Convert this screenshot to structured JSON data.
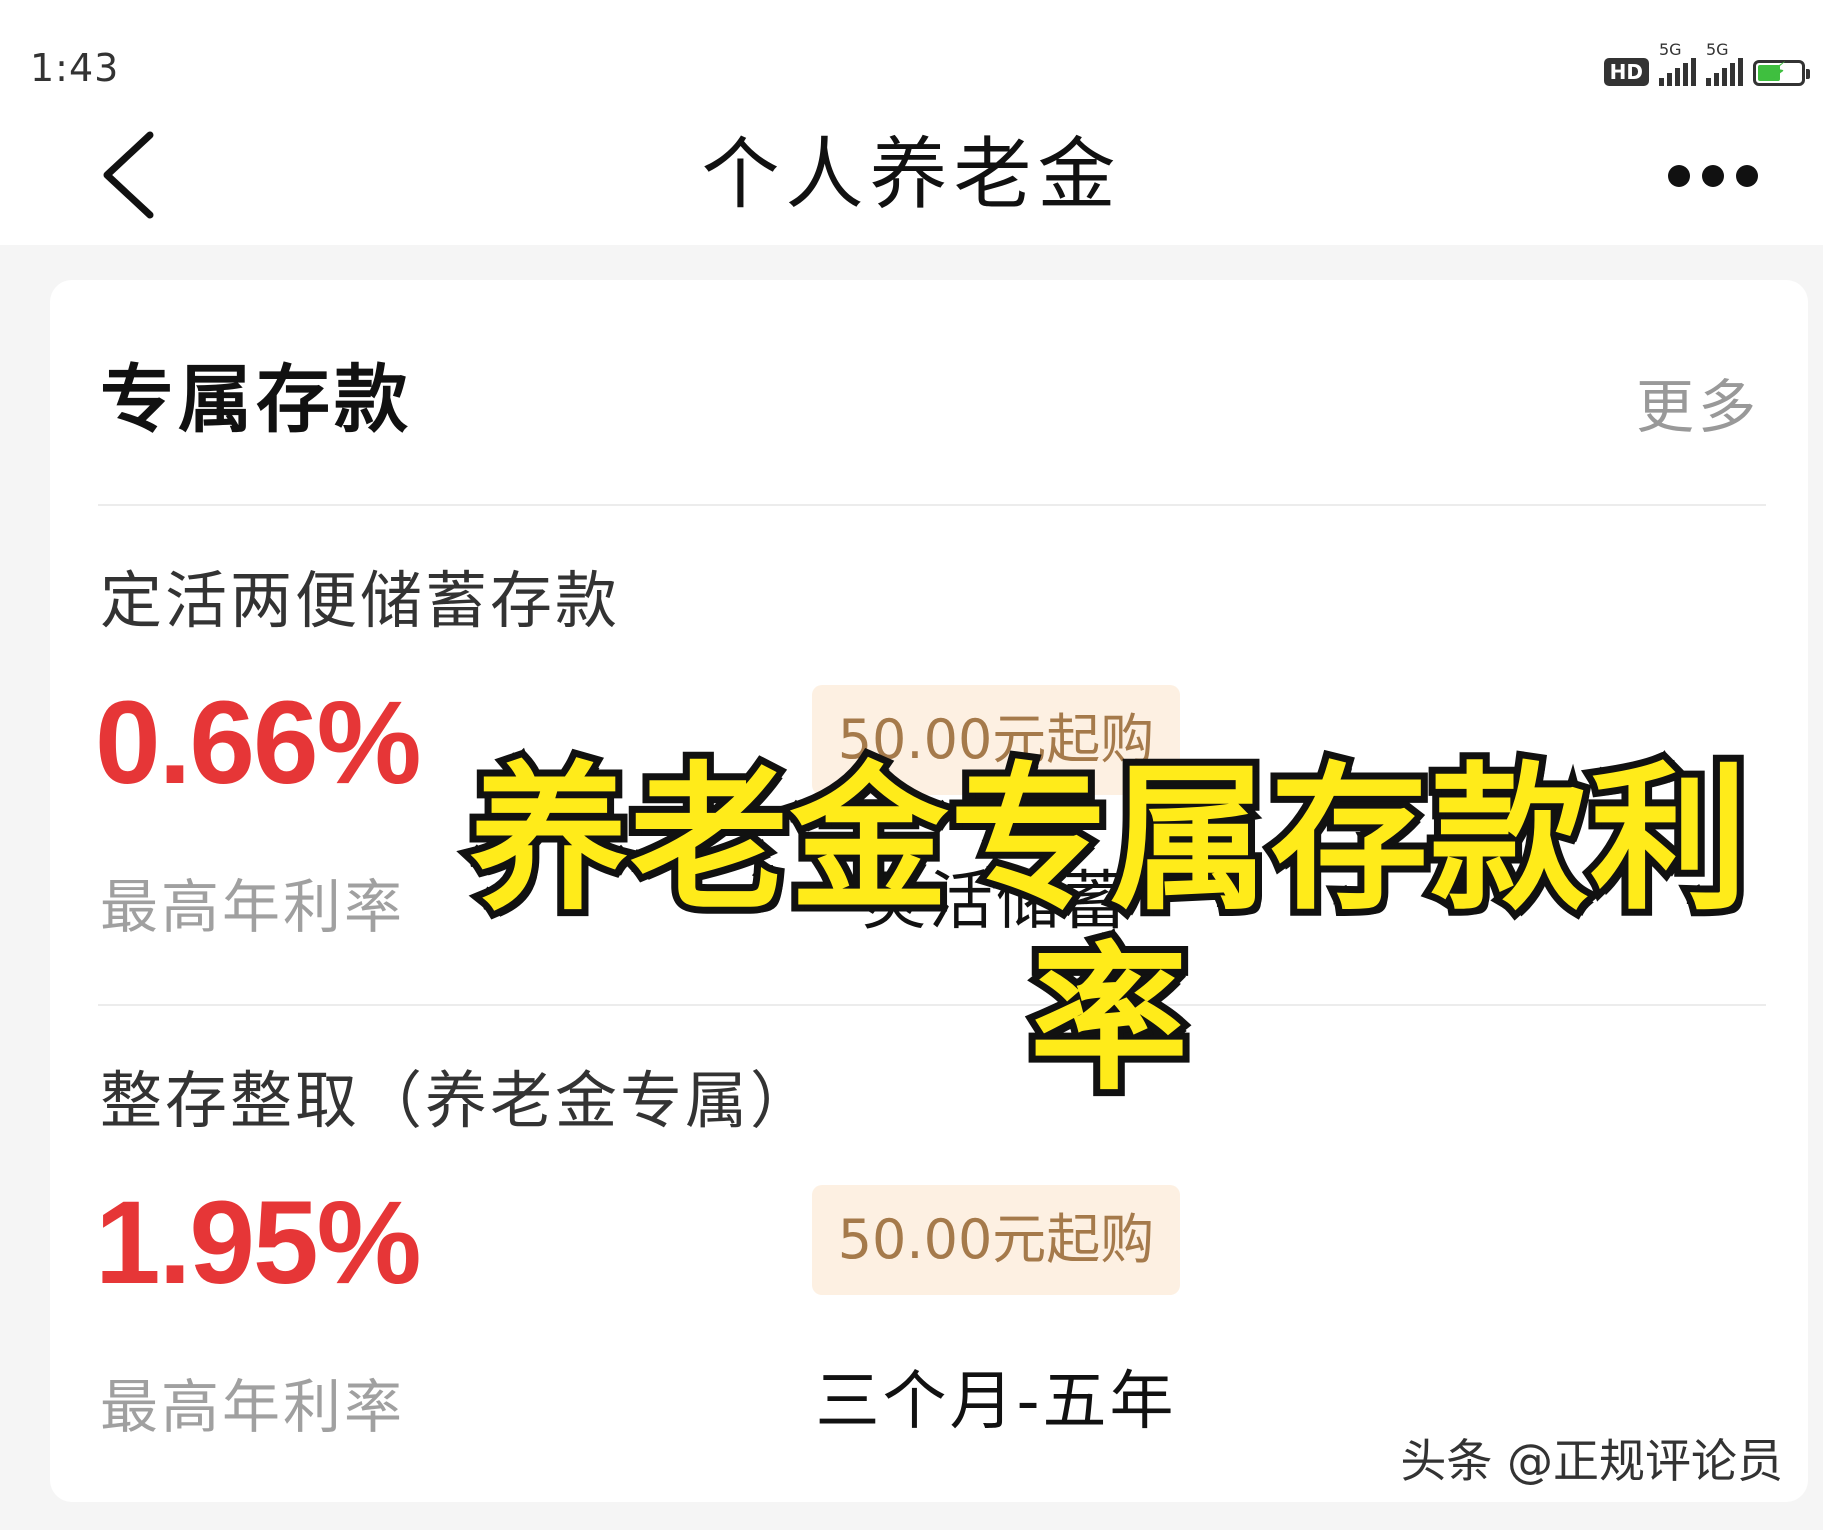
{
  "status_bar": {
    "time": "1:43",
    "hd_label": "HD",
    "signal_1_label": "5G",
    "signal_2_label": "5G",
    "battery_color": "#3fbf3f"
  },
  "nav": {
    "title": "个人养老金",
    "back_icon": "chevron-left-icon",
    "more_icon": "more-dots-icon"
  },
  "section": {
    "title": "专属存款",
    "more_label": "更多"
  },
  "products": [
    {
      "name": "定活两便储蓄存款",
      "rate": "0.66%",
      "rate_label": "最高年利率",
      "min_amount": "50.00元起购",
      "term": "灵活储蓄"
    },
    {
      "name": "整存整取（养老金专属）",
      "rate": "1.95%",
      "rate_label": "最高年利率",
      "min_amount": "50.00元起购",
      "term": "三个月-五年"
    }
  ],
  "overlay": {
    "caption": "养老金专属存款利率"
  },
  "watermark": "头条 @正规评论员",
  "colors": {
    "rate": "#e63637",
    "badge_bg": "#fdf0e2",
    "badge_text": "#a57a4b",
    "overlay_text": "#ffeb1a"
  }
}
